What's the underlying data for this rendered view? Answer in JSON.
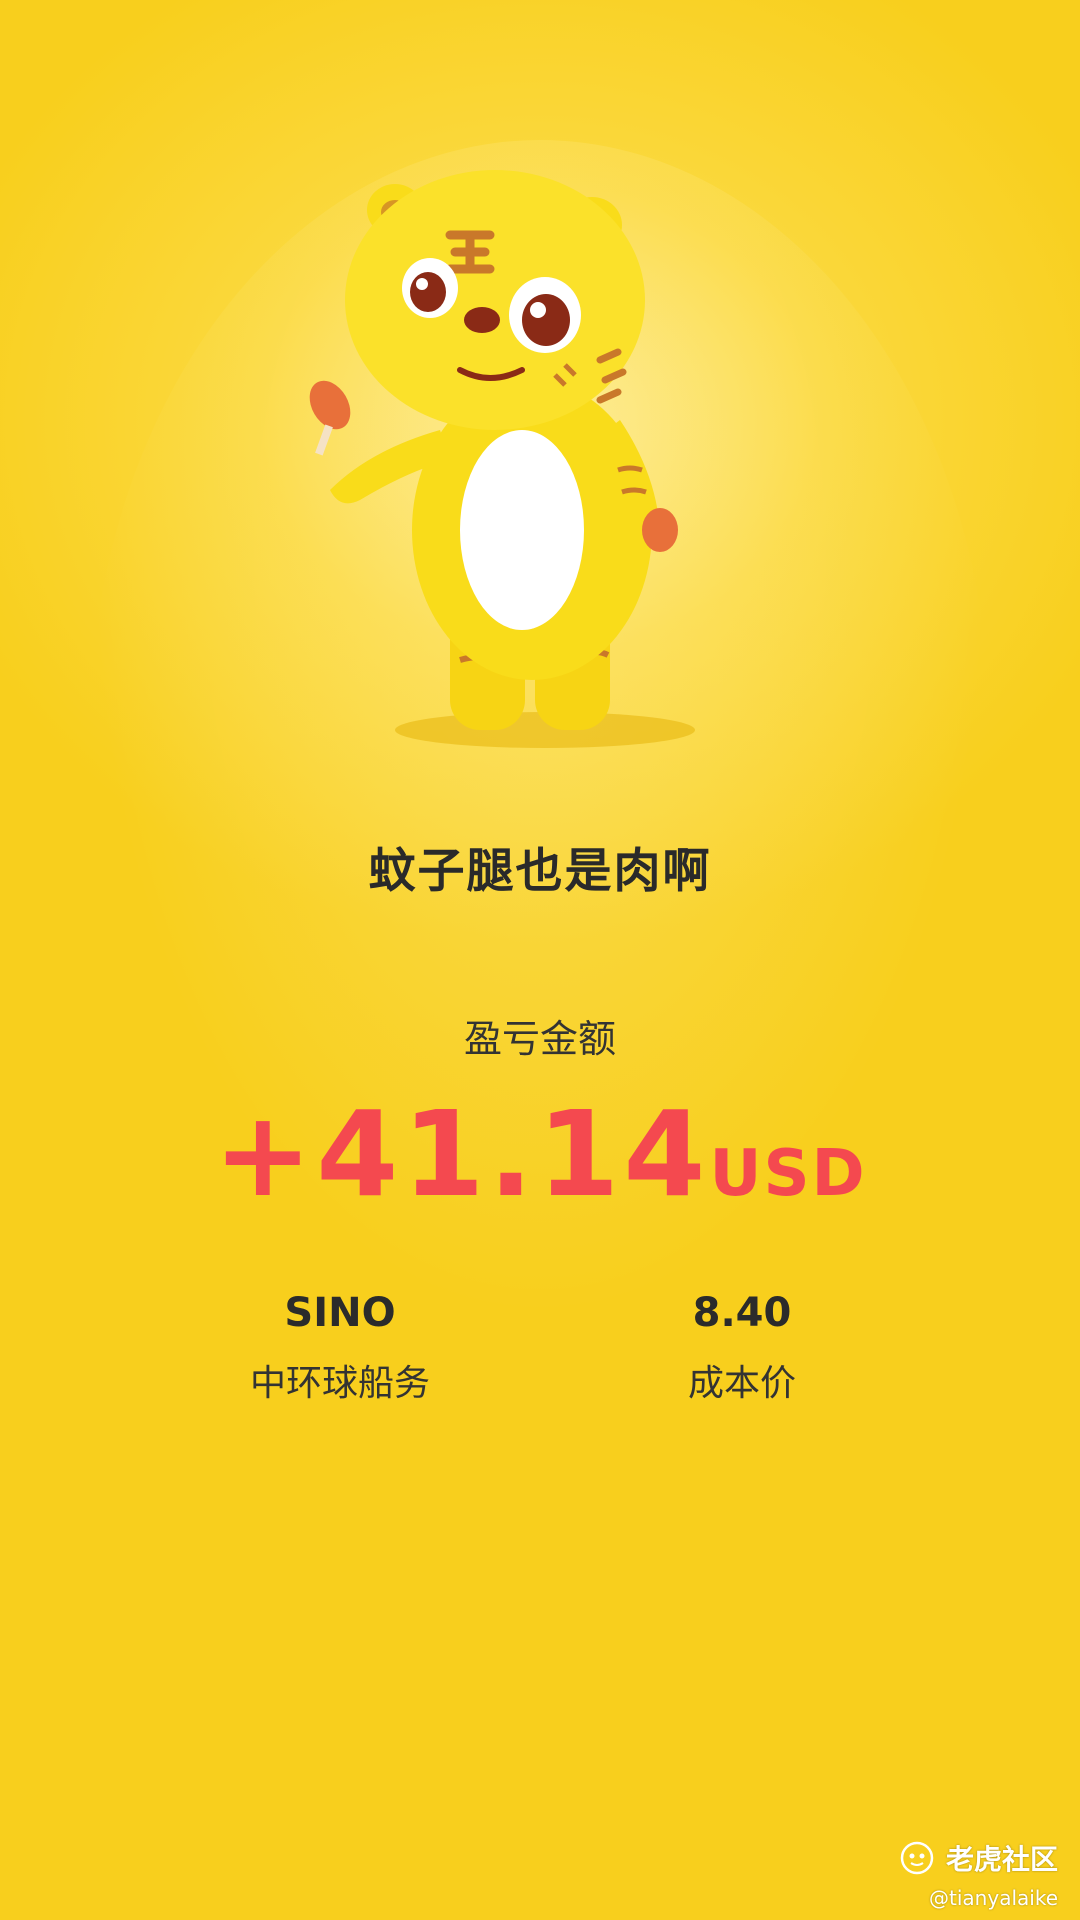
{
  "nickname": "蚊子腿也是肉啊",
  "pnl": {
    "label": "盈亏金额",
    "amount": "+41.14",
    "currency": "USD",
    "color": "#f4494f"
  },
  "stock": {
    "ticker": "SINO",
    "name": "中环球船务"
  },
  "cost": {
    "value": "8.40",
    "label": "成本价"
  },
  "watermark": {
    "brand": "老虎社区",
    "handle": "@tianyalaike",
    "icon": "tiger-logo-icon"
  },
  "mascot": "tiger-mascot-image",
  "colors": {
    "background": "#f8cf1d",
    "text_dark": "#2a2a2a",
    "profit_red": "#f4494f"
  }
}
